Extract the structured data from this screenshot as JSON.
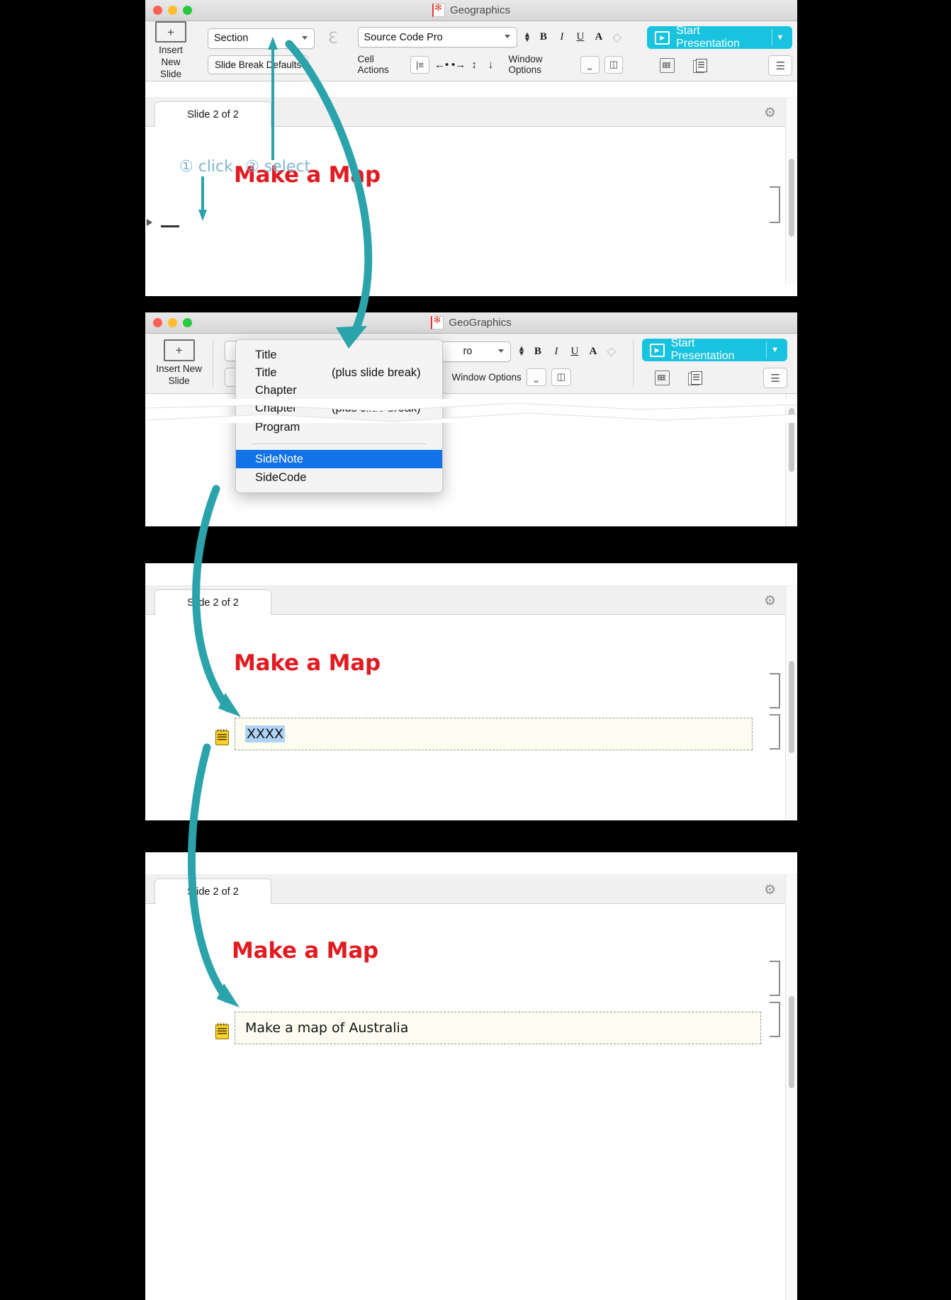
{
  "window1": {
    "title": "Geographics",
    "traffic_lights": [
      "close",
      "minimize",
      "zoom"
    ],
    "toolbar": {
      "insert_new_slide": "Insert New\nSlide",
      "insert_line1": "Insert New",
      "insert_line2": "Slide",
      "style_popup": "Section",
      "slide_break_defaults": "Slide Break Defaults",
      "font_popup": "Source Code Pro",
      "cell_actions_label": "Cell Actions",
      "window_options_label": "Window Options",
      "start_presentation": "Start Presentation",
      "bold": "B",
      "italic": "I",
      "underline": "U",
      "fontcolor": "A",
      "clear": "eraser-icon"
    },
    "tab_label": "Slide 2 of 2",
    "slide_title": "Make a Map"
  },
  "window2": {
    "title": "GeoGraphics",
    "toolbar": {
      "font_popup_partial": "ro",
      "window_options_label": "Window Options",
      "start_presentation": "Start Presentation",
      "insert_line1": "Insert New",
      "insert_line2": "Slide"
    },
    "menu": {
      "items": [
        {
          "label": "Title",
          "alt": ""
        },
        {
          "label": "Title",
          "alt": "(plus slide break)"
        },
        {
          "label": "Chapter",
          "alt": ""
        },
        {
          "label": "Chapter",
          "alt": "(plus slide break)"
        },
        {
          "label": "Program",
          "alt": ""
        }
      ],
      "group2": [
        {
          "label": "SideNote",
          "selected": true
        },
        {
          "label": "SideCode",
          "selected": false
        }
      ]
    }
  },
  "window3": {
    "tab_label": "Slide 2 of 2",
    "slide_title": "Make a Map",
    "cell_text": "XXXX",
    "cell_icon": "notepad-icon"
  },
  "window4": {
    "tab_label": "Slide 2 of 2",
    "slide_title": "Make a Map",
    "cell_text": "Make a map of Australia",
    "cell_icon": "notepad-icon"
  },
  "annotations": {
    "step1": "① click",
    "step2": "② select",
    "arrow_color": "#2ba3ab",
    "label_color": "#7fb6d4"
  },
  "colors": {
    "accent_cyan": "#18c3e0",
    "title_red": "#e11b22",
    "menu_highlight": "#1272e8",
    "cell_bg": "#fdfcf0",
    "selection_blue": "#aed3f5",
    "arrow_teal": "#2ba3ab"
  }
}
